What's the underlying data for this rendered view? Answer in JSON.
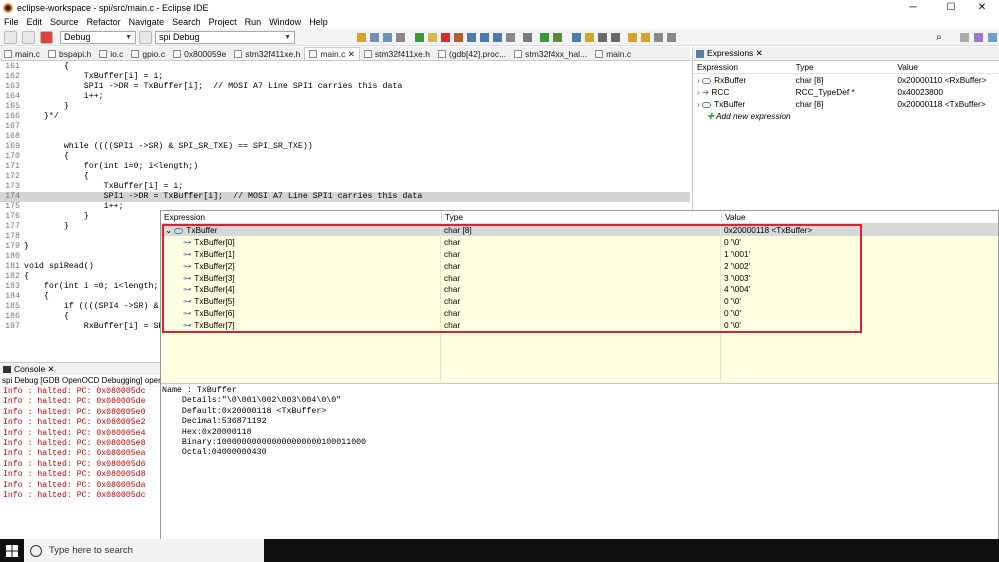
{
  "window": {
    "title": "eclipse-workspace - spi/src/main.c - Eclipse IDE",
    "minimize": "─",
    "maximize": "☐",
    "close": "✕"
  },
  "menu": [
    "File",
    "Edit",
    "Source",
    "Refactor",
    "Navigate",
    "Search",
    "Project",
    "Run",
    "Window",
    "Help"
  ],
  "toolbar": {
    "launch_mode": "Debug",
    "launch_config": "spi Debug"
  },
  "editor_tabs": [
    {
      "label": "main.c",
      "active": false
    },
    {
      "label": "bspapi.h",
      "active": false
    },
    {
      "label": "io.c",
      "active": false
    },
    {
      "label": "gpio.c",
      "active": false
    },
    {
      "label": "0x800059e",
      "active": false
    },
    {
      "label": "stm32f411xe.h",
      "active": false
    },
    {
      "label": "main.c ✕",
      "active": true
    },
    {
      "label": "stm32f411xe.h",
      "active": false
    },
    {
      "label": "(gdb[42].proc...",
      "active": false
    },
    {
      "label": "stm32f4xx_hal...",
      "active": false
    },
    {
      "label": "main.c",
      "active": false
    }
  ],
  "code_lines": [
    {
      "n": "161",
      "text": "        {"
    },
    {
      "n": "162",
      "text": "            TxBuffer[i] = i;"
    },
    {
      "n": "163",
      "text": "            SPI1 ->DR = TxBuffer[i];  // MOSI A7 Line SPI1 carries this data"
    },
    {
      "n": "164",
      "text": "            i++;"
    },
    {
      "n": "165",
      "text": "        }"
    },
    {
      "n": "166",
      "text": "    }*/"
    },
    {
      "n": "167",
      "text": ""
    },
    {
      "n": "168",
      "text": ""
    },
    {
      "n": "169",
      "text": "        while ((((SPI1 ->SR) & SPI_SR_TXE) == SPI_SR_TXE))"
    },
    {
      "n": "170",
      "text": "        {"
    },
    {
      "n": "171",
      "text": "            for(int i=0; i<length;)"
    },
    {
      "n": "172",
      "text": "            {"
    },
    {
      "n": "173",
      "text": "                TxBuffer[i] = i;"
    },
    {
      "n": "174",
      "text": "                SPI1 ->DR = TxBuffer[i];  // MOSI A7 Line SPI1 carries this data"
    },
    {
      "n": "175",
      "text": "                i++;"
    },
    {
      "n": "176",
      "text": "            }"
    },
    {
      "n": "177",
      "text": "        }"
    },
    {
      "n": "178",
      "text": ""
    },
    {
      "n": "179",
      "text": "}"
    },
    {
      "n": "180",
      "text": ""
    },
    {
      "n": "181",
      "text": "void spiRead()"
    },
    {
      "n": "182",
      "text": "{"
    },
    {
      "n": "183",
      "text": "    for(int i =0; i<length;)"
    },
    {
      "n": "184",
      "text": "    {"
    },
    {
      "n": "185",
      "text": "        if ((((SPI4 ->SR) &"
    },
    {
      "n": "186",
      "text": "        {"
    },
    {
      "n": "187",
      "text": "            RxBuffer[i] = SP"
    }
  ],
  "expressions": {
    "tab_label": "Expressions ✕",
    "columns": [
      "Expression",
      "Type",
      "Value"
    ],
    "rows": [
      {
        "expr": "RxBuffer",
        "type": "char [8]",
        "value": "0x20000110 <RxBuffer>"
      },
      {
        "expr": "RCC",
        "type": "RCC_TypeDef *",
        "value": "0x40023800"
      },
      {
        "expr": "TxBuffer",
        "type": "char [8]",
        "value": "0x20000118 <TxBuffer>"
      }
    ],
    "add_new": "Add new expression"
  },
  "console": {
    "tab_label": "Console ✕",
    "subtitle": "spi Debug [GDB OpenOCD Debugging] openc",
    "lines": [
      "Info : halted: PC: 0x080005dc",
      "Info : halted: PC: 0x080005de",
      "Info : halted: PC: 0x080005e0",
      "Info : halted: PC: 0x080005e2",
      "Info : halted: PC: 0x080005e4",
      "Info : halted: PC: 0x080005e8",
      "Info : halted: PC: 0x080005ea",
      "Info : halted: PC: 0x080005d6",
      "Info : halted: PC: 0x080005d8",
      "Info : halted: PC: 0x080005da",
      "Info : halted: PC: 0x080005dc"
    ]
  },
  "hover_popup": {
    "columns": [
      "Expression",
      "Type",
      "Value"
    ],
    "root": {
      "expr": "TxBuffer",
      "type": "char [8]",
      "value": "0x20000118 <TxBuffer>"
    },
    "children": [
      {
        "expr": "TxBuffer[0]",
        "type": "char",
        "value": "0 '\\0'"
      },
      {
        "expr": "TxBuffer[1]",
        "type": "char",
        "value": "1 '\\001'"
      },
      {
        "expr": "TxBuffer[2]",
        "type": "char",
        "value": "2 '\\002'"
      },
      {
        "expr": "TxBuffer[3]",
        "type": "char",
        "value": "3 '\\003'"
      },
      {
        "expr": "TxBuffer[4]",
        "type": "char",
        "value": "4 '\\004'"
      },
      {
        "expr": "TxBuffer[5]",
        "type": "char",
        "value": "0 '\\0'"
      },
      {
        "expr": "TxBuffer[6]",
        "type": "char",
        "value": "0 '\\0'"
      },
      {
        "expr": "TxBuffer[7]",
        "type": "char",
        "value": "0 '\\0'"
      }
    ],
    "details": [
      "Name : TxBuffer",
      "    Details:\"\\0\\001\\002\\003\\004\\0\\0\"",
      "    Default:0x20000118 <TxBuffer>",
      "    Decimal:536871192",
      "    Hex:0x20000118",
      "    Binary:100000000000000000000100011000",
      "    Octal:04000000430"
    ]
  },
  "taskbar": {
    "search_placeholder": "Type here to search"
  },
  "colors": {
    "highlight_box": "#e0202a",
    "popup_bg": "#ffffe1",
    "console_text": "#c00000"
  }
}
